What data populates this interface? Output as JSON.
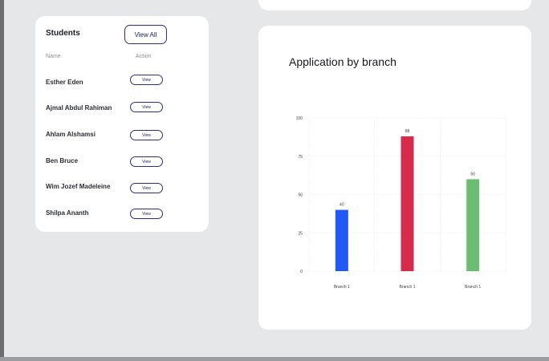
{
  "students": {
    "title": "Students",
    "view_all_label": "View All",
    "columns": [
      "Name",
      "Action"
    ],
    "rows": [
      {
        "name": "Esther Eden",
        "action": "View"
      },
      {
        "name": "Ajmal Abdul Rahiman",
        "action": "View"
      },
      {
        "name": "Ahlam Alshamsi",
        "action": "View"
      },
      {
        "name": "Ben Bruce",
        "action": "View"
      },
      {
        "name": "Wim Jozef Madeleine",
        "action": "View"
      },
      {
        "name": "Shilpa Ananth",
        "action": "View"
      }
    ]
  },
  "chart": {
    "title": "Application by branch"
  },
  "chart_data": {
    "type": "bar",
    "title": "Application by branch",
    "categories": [
      "Branch 1",
      "Branch 1",
      "Branch 1"
    ],
    "values": [
      40,
      88,
      60
    ],
    "colors": [
      "#2458f5",
      "#d62c4a",
      "#6bbd72"
    ],
    "ylim": [
      0,
      100
    ],
    "yticks": [
      0,
      25,
      50,
      75,
      100
    ],
    "data_labels": [
      "40",
      "88",
      "60"
    ],
    "grid": true,
    "xlabel": "",
    "ylabel": ""
  }
}
